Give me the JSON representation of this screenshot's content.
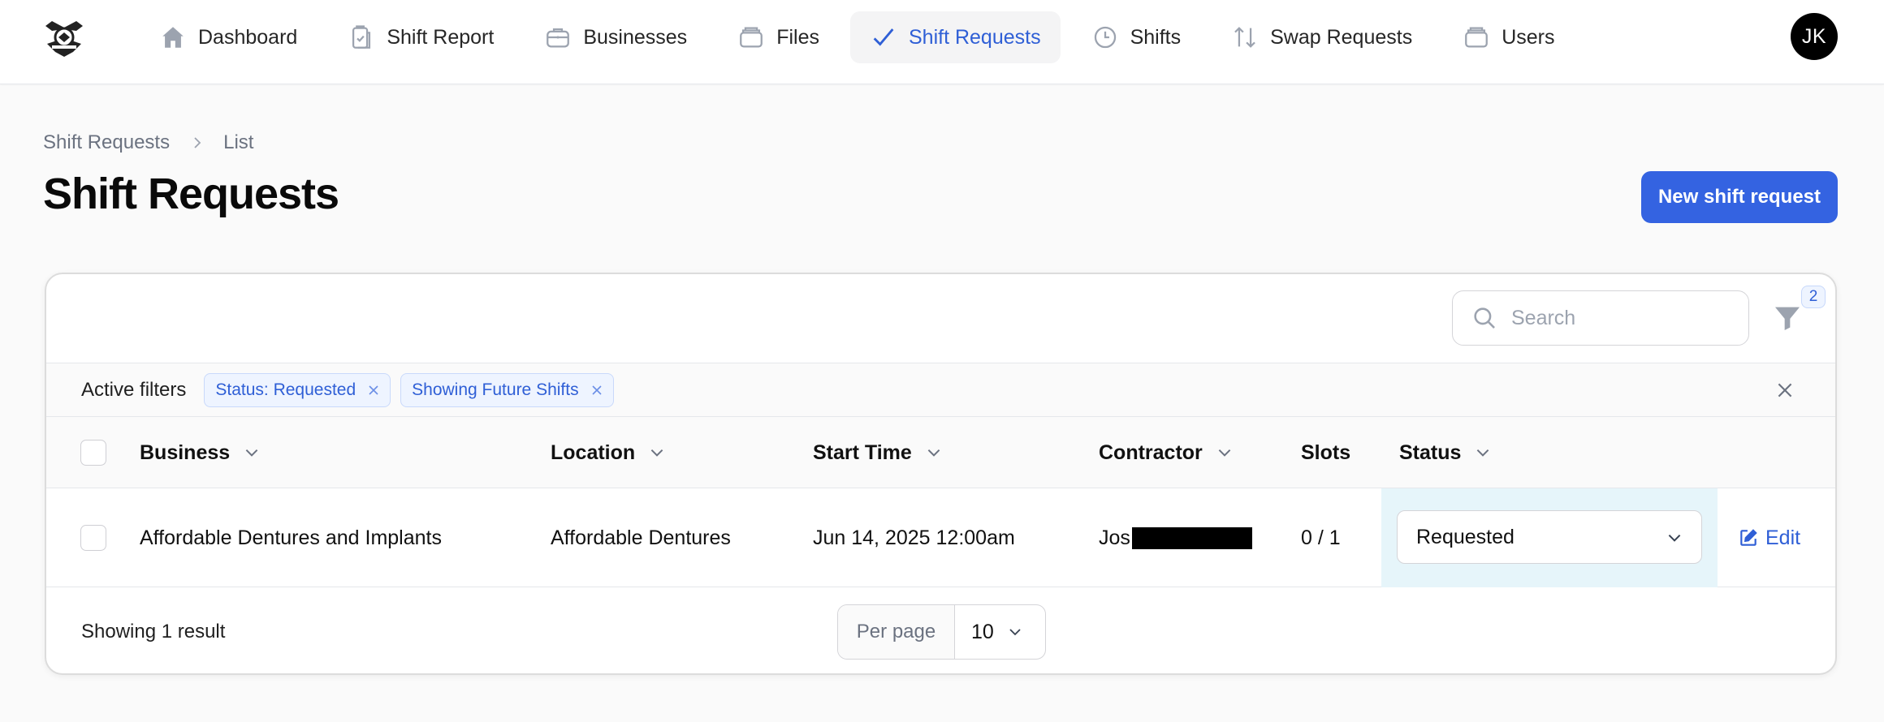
{
  "nav": {
    "items": [
      {
        "label": "Dashboard",
        "icon": "home-icon",
        "active": false
      },
      {
        "label": "Shift Report",
        "icon": "clipboard-check-icon",
        "active": false
      },
      {
        "label": "Businesses",
        "icon": "briefcase-icon",
        "active": false
      },
      {
        "label": "Files",
        "icon": "folder-icon",
        "active": false
      },
      {
        "label": "Shift Requests",
        "icon": "check-icon",
        "active": true
      },
      {
        "label": "Shifts",
        "icon": "clock-icon",
        "active": false
      },
      {
        "label": "Swap Requests",
        "icon": "arrows-up-down-icon",
        "active": false
      },
      {
        "label": "Users",
        "icon": "folder-icon",
        "active": false
      }
    ],
    "user_initials": "JK"
  },
  "breadcrumb": {
    "parent": "Shift Requests",
    "current": "List"
  },
  "page": {
    "title": "Shift Requests",
    "new_button_label": "New shift request"
  },
  "table": {
    "search_placeholder": "Search",
    "filter_count": "2",
    "active_filters_label": "Active filters",
    "active_filters": [
      "Status: Requested",
      "Showing Future Shifts"
    ],
    "columns": [
      "Business",
      "Location",
      "Start Time",
      "Contractor",
      "Slots",
      "Status"
    ],
    "rows": [
      {
        "business": "Affordable Dentures and Implants",
        "location": "Affordable Dentures",
        "start_time": "Jun 14, 2025 12:00am",
        "contractor": "Jos",
        "slots": "0 / 1",
        "status": "Requested",
        "edit_label": "Edit"
      }
    ],
    "showing_text": "Showing 1 result",
    "per_page_label": "Per page",
    "per_page_value": "10"
  },
  "colors": {
    "accent": "#3463e1",
    "active_nav_text": "#2f5fd6",
    "status_cell_bg": "#e6f5fa"
  }
}
